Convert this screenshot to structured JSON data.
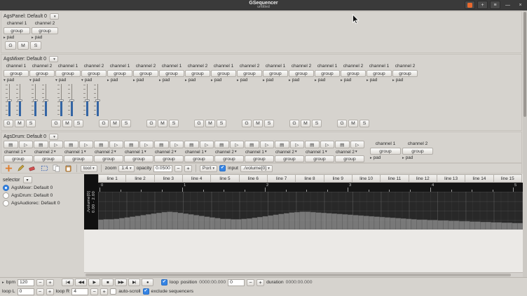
{
  "colors": {
    "accent": "#3584e4",
    "titlebar": "#3a3a3a",
    "lane_bg": "#282828",
    "envelope_fill": "#8f8f8f"
  },
  "icons": {
    "combo_arrow": "▾",
    "expander_open": "▾",
    "expander_closed": "▸",
    "check": "✔",
    "pad_open_glyph": "▤",
    "pad_play_glyph": "▷",
    "nav_expander": "▸"
  },
  "titlebar": {
    "title": "GSequencer",
    "subtitle": "untitled",
    "add_button": "+",
    "menu_button": "≡",
    "minimize_button": "—",
    "close_button": "×"
  },
  "machines": {
    "panel": {
      "title": "AgsPanel: Default 0",
      "channels": [
        "channel 1",
        "channel 2"
      ],
      "group_label": "group",
      "pad_label": "pad",
      "gms": [
        "G",
        "M",
        "S"
      ]
    },
    "mixer": {
      "title": "AgsMixer: Default 0",
      "channels": [
        "channel 1",
        "channel 2",
        "channel 1",
        "channel 2",
        "channel 1",
        "channel 2",
        "channel 1",
        "channel 2",
        "channel 1",
        "channel 2",
        "channel 1",
        "channel 2",
        "channel 1",
        "channel 2",
        "channel 1",
        "channel 2"
      ],
      "group_label": "group",
      "pad_label": "pad",
      "expanded_pads": 4,
      "gms": [
        "G",
        "M",
        "S"
      ],
      "gms_sets": 8
    },
    "drum": {
      "title": "AgsDrum: Default 0",
      "pad_lines": [
        "channel 1",
        "channel 2",
        "channel 1",
        "channel 2",
        "channel 1",
        "channel 2",
        "channel 1",
        "channel 2",
        "channel 1",
        "channel 2",
        "channel 1",
        "channel 2"
      ],
      "group_label": "group",
      "pad_label": "pad",
      "right_channels": [
        "channel 1",
        "channel 2"
      ]
    }
  },
  "automation_toolbar": {
    "tools": [
      "position",
      "edit",
      "clear",
      "select",
      "copy",
      "paste"
    ],
    "tool_label": "tool",
    "zoom_label": "zoom",
    "zoom_value": "1:4",
    "opacity_label": "opacity",
    "opacity_value": "0.0500",
    "minus": "−",
    "plus": "+",
    "port_label": "Port",
    "input_label": "input",
    "input_value": "./volume[0]",
    "input_checked": true
  },
  "selector": {
    "label": "selector",
    "items": [
      {
        "label": "AgsMixer: Default 0",
        "selected": true
      },
      {
        "label": "AgsDrum: Default 0",
        "selected": false
      },
      {
        "label": "AgsAudiorec: Default 0",
        "selected": false
      }
    ]
  },
  "editor": {
    "line_headers": [
      "line 1",
      "line 2",
      "line 3",
      "line 4",
      "line 5",
      "line 6",
      "line 7",
      "line 8",
      "line 9",
      "line 10",
      "line 11",
      "line 12",
      "line 13",
      "line 14",
      "line 15"
    ],
    "ruler_labels": [
      "0",
      "1",
      "2",
      "3",
      "4",
      "5"
    ],
    "lane": {
      "port": "./volume[0]",
      "range": "0.00 - 2.00"
    },
    "envelope": [
      0.26,
      0.27,
      0.27,
      0.28,
      0.3,
      0.32,
      0.34,
      0.36,
      0.38,
      0.4,
      0.42,
      0.44,
      0.46,
      0.47,
      0.46,
      0.44,
      0.42,
      0.4,
      0.38,
      0.36,
      0.34,
      0.32,
      0.3,
      0.28,
      0.28,
      0.27,
      0.27,
      0.28,
      0.29,
      0.31,
      0.33,
      0.35,
      0.37,
      0.39,
      0.41,
      0.43,
      0.45,
      0.46,
      0.47,
      0.47,
      0.46,
      0.45,
      0.44,
      0.43,
      0.42,
      0.41,
      0.4,
      0.39,
      0.38,
      0.37,
      0.36,
      0.35,
      0.34,
      0.33,
      0.32,
      0.31,
      0.3,
      0.29,
      0.28,
      0.27,
      0.26,
      0.26,
      0.25,
      0.25,
      0.24,
      0.24,
      0.23,
      0.23,
      0.22,
      0.22,
      0.21,
      0.21,
      0.2,
      0.2,
      0.19,
      0.19,
      0.18,
      0.18,
      0.17,
      0.17
    ]
  },
  "transport": {
    "bpm_label": "bpm",
    "bpm_value": "120",
    "minus": "−",
    "plus": "+",
    "buttons": [
      {
        "name": "jump-begin",
        "glyph": "|◀"
      },
      {
        "name": "rewind",
        "glyph": "◀◀"
      },
      {
        "name": "play",
        "glyph": "▶"
      },
      {
        "name": "stop",
        "glyph": "■"
      },
      {
        "name": "forward",
        "glyph": "▶▶"
      },
      {
        "name": "jump-end",
        "glyph": "▶|"
      },
      {
        "name": "record",
        "glyph": "●"
      }
    ],
    "loop_label": "loop",
    "loop_checked": true,
    "position_label": "position",
    "position_value": "0000:00.000",
    "offset_value": "0",
    "duration_label": "duration",
    "duration_value": "0000:00.000"
  },
  "footer": {
    "loop_l_label": "loop L",
    "loop_l_value": "0",
    "loop_r_label": "loop R",
    "loop_r_value": "4",
    "autoscroll_label": "auto-scroll",
    "autoscroll_checked": false,
    "exclude_label": "exclude sequencers",
    "exclude_checked": true
  }
}
